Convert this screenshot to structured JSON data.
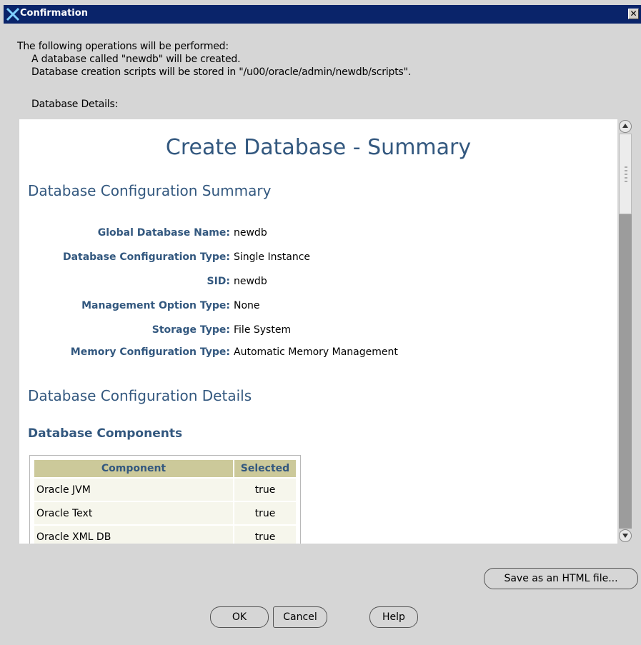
{
  "window": {
    "title": "Confirmation"
  },
  "intro": {
    "line1": "The following operations will be performed:",
    "line2": "A database called \"newdb\" will be created.",
    "line3": "Database creation scripts will be stored in \"/u00/oracle/admin/newdb/scripts\".",
    "details_label": "Database Details:"
  },
  "summary": {
    "title": "Create Database - Summary",
    "config_summary_heading": "Database Configuration Summary",
    "fields": [
      {
        "label": "Global Database Name:",
        "value": "newdb"
      },
      {
        "label": "Database Configuration Type:",
        "value": "Single Instance"
      },
      {
        "label": "SID:",
        "value": "newdb"
      },
      {
        "label": "Management Option Type:",
        "value": "None"
      },
      {
        "label": "Storage Type:",
        "value": "File System"
      },
      {
        "label": "Memory Configuration Type:",
        "value": "Automatic Memory Management"
      }
    ],
    "config_details_heading": "Database Configuration Details",
    "components_heading": "Database Components",
    "components_table": {
      "headers": [
        "Component",
        "Selected"
      ],
      "rows": [
        [
          "Oracle JVM",
          "true"
        ],
        [
          "Oracle Text",
          "true"
        ],
        [
          "Oracle XML DB",
          "true"
        ]
      ]
    }
  },
  "buttons": {
    "save_html": "Save as an HTML file...",
    "ok": "OK",
    "cancel": "Cancel",
    "help": "Help"
  },
  "colors": {
    "heading": "#33587f",
    "titlebar": "#0a246a",
    "table_header": "#ccc99a"
  }
}
